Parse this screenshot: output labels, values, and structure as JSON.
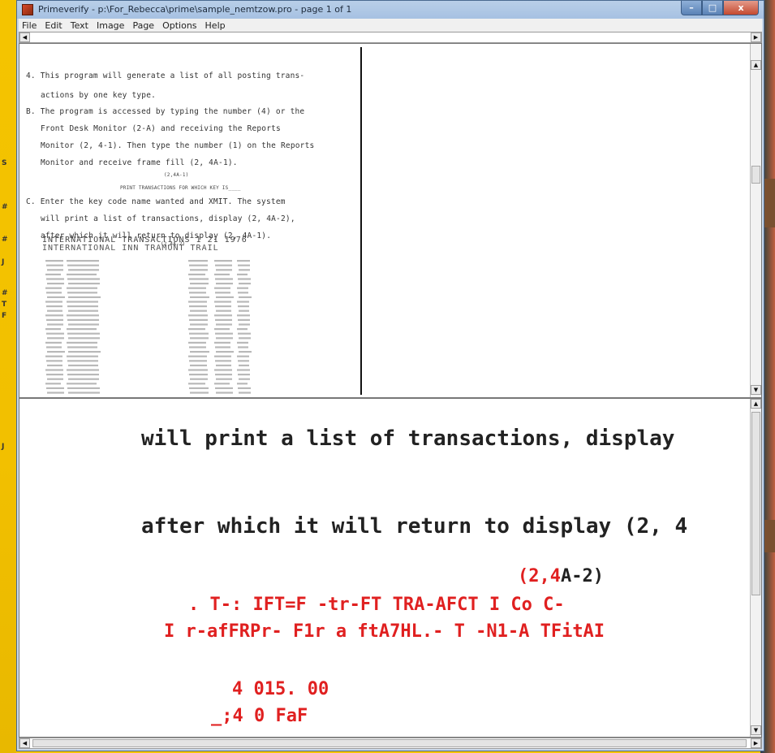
{
  "window": {
    "title": "Primeverify -  p:\\For_Rebecca\\prime\\sample_nemtzow.pro  - page 1 of 1",
    "minimize_glyph": "–",
    "maximize_glyph": "□",
    "close_glyph": "x"
  },
  "menu": [
    "File",
    "Edit",
    "Text",
    "Image",
    "Page",
    "Options",
    "Help"
  ],
  "scan_page": {
    "lines": [
      "4. This program will generate a list of all posting trans-",
      "actions by one key type.",
      "B. The program is accessed by typing the number (4) or the",
      "Front Desk Monitor (2-A) and receiving the Reports",
      "Monitor (2, 4-1).  Then type the number (1) on the Reports",
      "Monitor and receive frame fill (2, 4A-1).",
      "(2,4A-1)",
      "PRINT TRANSACTIONS FOR WHICH KEY IS____",
      "C. Enter the key code name wanted and XMIT.  The system",
      "will print a list of transactions, display (2, 4A-2),",
      "after which it will return to display (2, 4A-1).",
      "(2,4A-2)"
    ],
    "table_header_1": "INTERNATIONAL TRANSACTIONS  1 21 1976",
    "table_header_2": "INTERNATIONAL INN TRAMONT  TRAIL"
  },
  "zoom_text": {
    "line1": "will print a list of transactions, display",
    "line2": "after which it will return to display (2, 4",
    "line3_red": "(2,",
    "line3_red2": "4",
    "line3_black": "A-2)",
    "line4": ".     T-:  IFT=F -tr-FT  TRA-AFCT I Co C-",
    "line5": "I r-afFRPr- F1r a ftA7HL.- T -N1-A TFitAI",
    "line6": "4    015. 00",
    "line7": "_;4    0  FaF"
  }
}
